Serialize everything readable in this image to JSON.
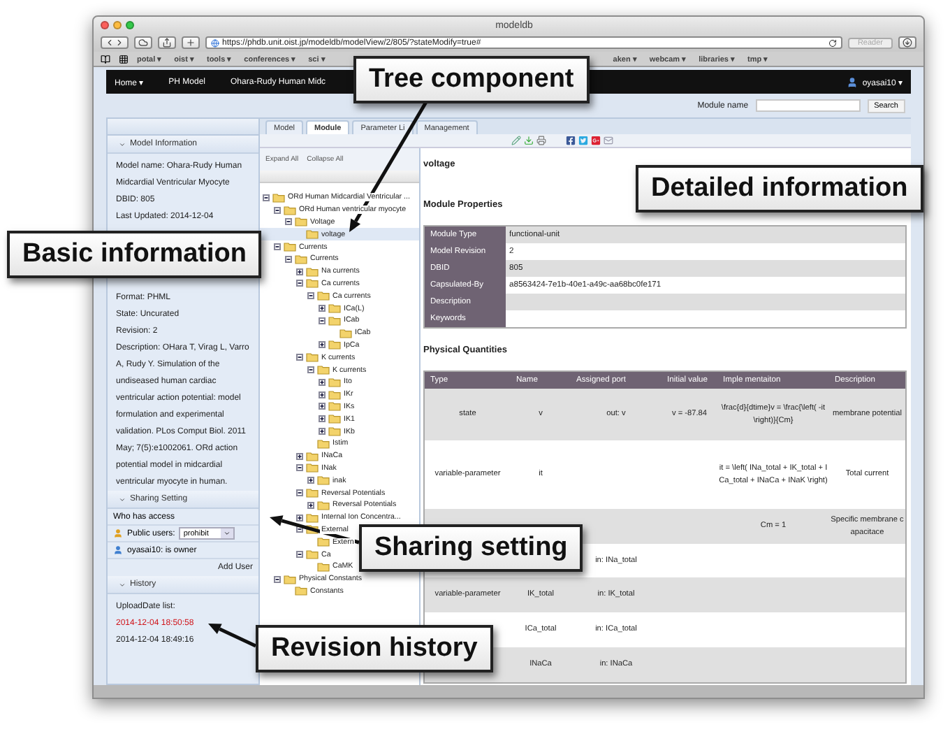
{
  "browser": {
    "title": "modeldb",
    "url": "https://phdb.unit.oist.jp/modeldb/modelView/2/805/?stateModify=true#",
    "reader": "Reader",
    "bookmarks_left": [
      "potal ▾",
      "oist ▾",
      "tools ▾",
      "conferences ▾",
      "sci ▾"
    ],
    "bookmarks_right": [
      "aken ▾",
      "webcam ▾",
      "libraries ▾",
      "tmp ▾"
    ]
  },
  "navbar": {
    "items": [
      "Home ▾",
      "PH Model",
      "Ohara-Rudy Human Midc"
    ],
    "user": "oyasai10 ▾"
  },
  "search": {
    "label": "Module name",
    "button": "Search"
  },
  "model_info": {
    "title": "Model Information",
    "lines_top": [
      "Model name:  Ohara-Rudy Human Midcardial Ventricular Myocyte",
      "DBID:  805",
      "Last Updated:  2014-12-04"
    ],
    "lines_bottom": [
      "Format:  PHML",
      "State:  Uncurated",
      "Revision:  2",
      "Description:  OHara T, Virag L, Varro A, Rudy Y. Simulation of the undiseased human cardiac ventricular action potential: model formulation and experimental validation. PLos Comput Biol. 2011 May; 7(5):e1002061. ORd action potential model in midcardial ventricular myocyte in human."
    ]
  },
  "sharing": {
    "title": "Sharing Setting",
    "who": "Who has access",
    "public_label": "Public users:",
    "public_value": "prohibit",
    "owner": "oyasai10:  is owner",
    "add_user": "Add User"
  },
  "history": {
    "title": "History",
    "label": "UploadDate list:",
    "dates": [
      {
        "text": "2014-12-04 18:50:58",
        "selected": true
      },
      {
        "text": "2014-12-04 18:49:16",
        "selected": false
      }
    ]
  },
  "tabs": [
    {
      "label": "Model",
      "selected": false
    },
    {
      "label": "Module",
      "selected": true
    },
    {
      "label": "Parameter Li",
      "selected": false
    },
    {
      "label": "Management",
      "selected": false
    }
  ],
  "tree": {
    "expand": "Expand All",
    "collapse": "Collapse All",
    "items": [
      {
        "label": "ORd Human Midcardial Ventricular ...",
        "expanded": true,
        "selected": false,
        "children": [
          {
            "label": "ORd Human ventricular myocyte",
            "expanded": true,
            "selected": false,
            "children": [
              {
                "label": "Voltage",
                "expanded": true,
                "selected": false,
                "children": [
                  {
                    "label": "voltage",
                    "selected": true
                  }
                ]
              }
            ]
          },
          {
            "label": "Currents",
            "expanded": true,
            "selected": false,
            "children": [
              {
                "label": "Currents",
                "expanded": true,
                "selected": false,
                "children": [
                  {
                    "label": "Na currents",
                    "expanded": false,
                    "selected": false
                  },
                  {
                    "label": "Ca currents",
                    "expanded": true,
                    "selected": false,
                    "children": [
                      {
                        "label": "Ca currents",
                        "expanded": true,
                        "selected": false,
                        "children": [
                          {
                            "label": "ICa(L)",
                            "expanded": false,
                            "selected": false
                          },
                          {
                            "label": "ICab",
                            "expanded": true,
                            "selected": false,
                            "children": [
                              {
                                "label": "ICab",
                                "selected": false
                              }
                            ]
                          },
                          {
                            "label": "IpCa",
                            "expanded": false,
                            "selected": false
                          }
                        ]
                      }
                    ]
                  },
                  {
                    "label": "K currents",
                    "expanded": true,
                    "selected": false,
                    "children": [
                      {
                        "label": "K currents",
                        "expanded": true,
                        "selected": false,
                        "children": [
                          {
                            "label": "Ito",
                            "expanded": false,
                            "selected": false
                          },
                          {
                            "label": "IKr",
                            "expanded": false,
                            "selected": false
                          },
                          {
                            "label": "IKs",
                            "expanded": false,
                            "selected": false
                          },
                          {
                            "label": "IK1",
                            "expanded": false,
                            "selected": false
                          },
                          {
                            "label": "IKb",
                            "expanded": false,
                            "selected": false
                          }
                        ]
                      },
                      {
                        "label": "Istim",
                        "selected": false
                      }
                    ]
                  },
                  {
                    "label": "INaCa",
                    "expanded": false,
                    "selected": false
                  },
                  {
                    "label": "INak",
                    "expanded": true,
                    "selected": false,
                    "children": [
                      {
                        "label": "inak",
                        "expanded": false,
                        "selected": false
                      }
                    ]
                  },
                  {
                    "label": "Reversal Potentials",
                    "expanded": true,
                    "selected": false,
                    "children": [
                      {
                        "label": "Reversal Potentials",
                        "expanded": false,
                        "selected": false
                      }
                    ]
                  },
                  {
                    "label": "Internal Ion Concentra...",
                    "expanded": false,
                    "selected": false
                  },
                  {
                    "label": "External",
                    "expanded": true,
                    "selected": false,
                    "children": [
                      {
                        "label": "Extern",
                        "selected": false
                      }
                    ]
                  },
                  {
                    "label": "Ca",
                    "expanded": true,
                    "selected": false,
                    "children": [
                      {
                        "label": "CaMK",
                        "selected": false
                      }
                    ]
                  }
                ]
              }
            ]
          },
          {
            "label": "Physical Constants",
            "expanded": true,
            "selected": false,
            "children": [
              {
                "label": "Constants",
                "selected": false
              }
            ]
          }
        ]
      }
    ]
  },
  "detail": {
    "title": "voltage",
    "properties_heading": "Module Properties",
    "properties": [
      {
        "label": "Module Type",
        "value": "functional-unit"
      },
      {
        "label": "Model Revision",
        "value": "2"
      },
      {
        "label": "DBID",
        "value": "805"
      },
      {
        "label": "Capsulated-By",
        "value": "a8563424-7e1b-40e1-a49c-aa68bc0fe171"
      },
      {
        "label": "Description"
      },
      {
        "label": "Keywords"
      }
    ],
    "quantities_heading": "Physical Quantities",
    "columns": [
      "Type",
      "Name",
      "Assigned port",
      "Initial value",
      "Imple mentaiton",
      "Description"
    ],
    "rows": [
      {
        "type": "state",
        "name": "v",
        "port": "out: v",
        "initial": "v = -87.84",
        "implementation": "\\frac{d}{dtime}v = \\frac{\\left( -it \\right)}{Cm}",
        "description": "membrane potential"
      },
      {
        "type": "variable-parameter",
        "name": "it",
        "implementation": "it = \\left( INa_total + IK_total + ICa_total + INaCa + INaK \\right)",
        "description": "Total current"
      },
      {
        "implementation": "Cm = 1",
        "description": "Specific membrane capacitace"
      },
      {
        "port": "in: INa_total"
      },
      {
        "type": "variable-parameter",
        "name": "IK_total",
        "port": "in: IK_total"
      },
      {
        "name": "ICa_total",
        "port": "in: ICa_total"
      },
      {
        "name": "INaCa",
        "port": "in: INaCa"
      }
    ]
  },
  "callouts": [
    "Tree component",
    "Detailed information",
    "Basic information",
    "Sharing setting",
    "Revision history"
  ]
}
